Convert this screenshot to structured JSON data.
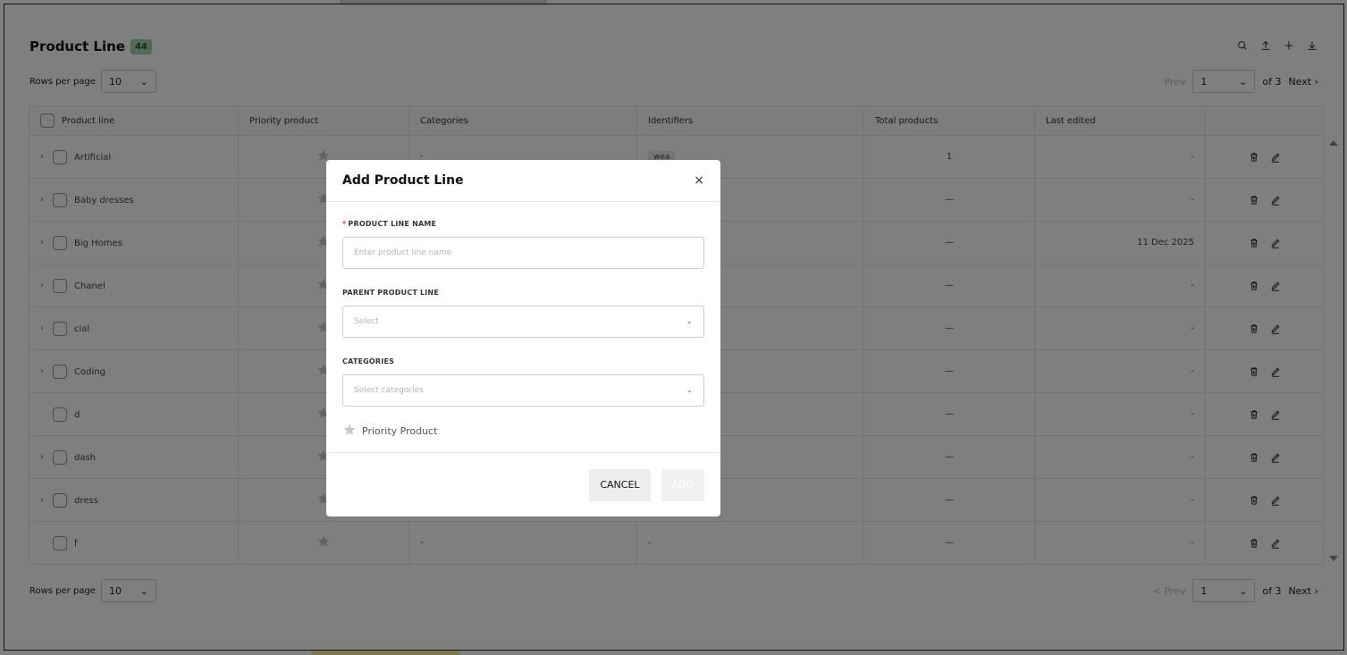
{
  "header": {
    "title": "Product Line",
    "count": "44"
  },
  "pager_top": {
    "rows_label": "Rows per page",
    "rows_value": "10",
    "prev": "Prev",
    "page": "1",
    "of": "of 3",
    "next": "Next"
  },
  "pager_bottom": {
    "rows_label": "Rows per page",
    "rows_value": "10",
    "prev": "< Prev",
    "page": "1",
    "of": "of 3",
    "next": "Next"
  },
  "table": {
    "columns": [
      "Product line",
      "Priority product",
      "Categories",
      "Identifiers",
      "Total products",
      "Last edited"
    ],
    "rows": [
      {
        "name": "Artificial",
        "expand": true,
        "categories": "-",
        "identifiers": "wea",
        "total": "1",
        "edited": "-"
      },
      {
        "name": "Baby dresses",
        "expand": true,
        "categories": "",
        "identifiers": "",
        "total": "—",
        "edited": "-"
      },
      {
        "name": "Big Homes",
        "expand": true,
        "categories": "",
        "identifiers": "",
        "total": "—",
        "edited": "11 Dec 2025"
      },
      {
        "name": "Chanel",
        "expand": true,
        "categories": "",
        "identifiers": "",
        "total": "—",
        "edited": "-"
      },
      {
        "name": "cial",
        "expand": true,
        "categories": "",
        "identifiers": "",
        "total": "—",
        "edited": "-"
      },
      {
        "name": "Coding",
        "expand": true,
        "categories": "",
        "identifiers": "",
        "total": "—",
        "edited": "-"
      },
      {
        "name": "d",
        "expand": false,
        "categories": "",
        "identifiers": "",
        "total": "—",
        "edited": "-"
      },
      {
        "name": "dash",
        "expand": true,
        "categories": "",
        "identifiers": "",
        "total": "—",
        "edited": "-"
      },
      {
        "name": "dress",
        "expand": true,
        "categories": "",
        "identifiers": "",
        "total": "—",
        "edited": "-"
      },
      {
        "name": "f",
        "expand": false,
        "categories": "-",
        "identifiers": "-",
        "total": "—",
        "edited": "-"
      }
    ]
  },
  "modal": {
    "title": "Add Product Line",
    "close": "×",
    "name_label": "PRODUCT LINE NAME",
    "name_placeholder": "Enter product line name",
    "parent_label": "PARENT PRODUCT LINE",
    "parent_placeholder": "Select",
    "categories_label": "CATEGORIES",
    "categories_placeholder": "Select categories",
    "priority_label": "Priority Product",
    "cancel": "CANCEL",
    "add": "ADD"
  },
  "icons": {
    "search": "search-icon",
    "upload": "upload-icon",
    "add": "plus-icon",
    "download": "download-icon",
    "delete": "trash-icon",
    "edit": "pencil-icon",
    "star": "star-icon"
  },
  "colors": {
    "badge_bg": "#9fd6a8",
    "required": "#e53935",
    "star": "#c8c8c8"
  }
}
